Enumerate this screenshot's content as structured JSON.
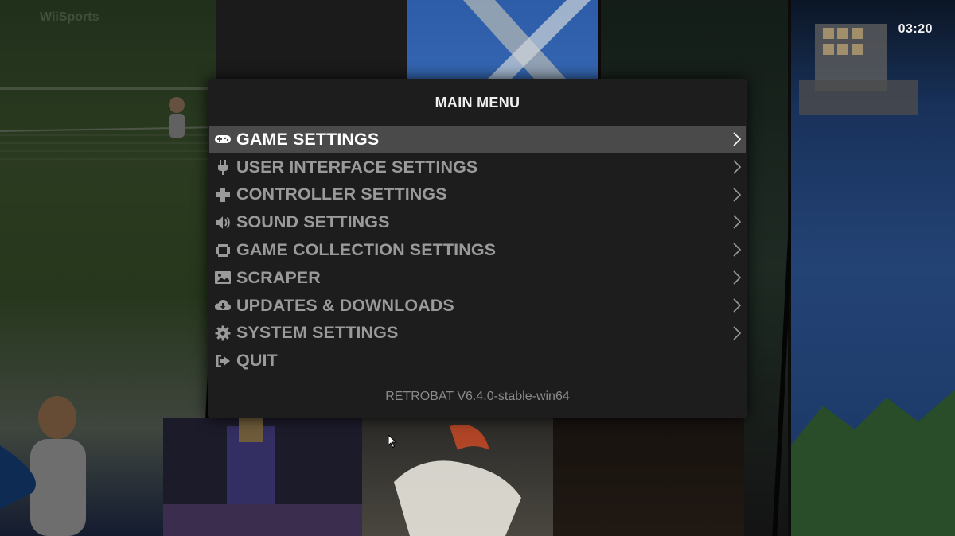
{
  "clock": "03:20",
  "background": {
    "watermark_text": "WiiSports"
  },
  "menu": {
    "title": "MAIN MENU",
    "items": [
      {
        "label": "GAME SETTINGS",
        "icon": "gamepad-icon",
        "selected": true,
        "has_submenu": true
      },
      {
        "label": "USER INTERFACE SETTINGS",
        "icon": "plug-icon",
        "selected": false,
        "has_submenu": true
      },
      {
        "label": "CONTROLLER SETTINGS",
        "icon": "dpad-cross-icon",
        "selected": false,
        "has_submenu": true
      },
      {
        "label": "SOUND SETTINGS",
        "icon": "speaker-icon",
        "selected": false,
        "has_submenu": true
      },
      {
        "label": "GAME COLLECTION SETTINGS",
        "icon": "collection-frame-icon",
        "selected": false,
        "has_submenu": true
      },
      {
        "label": "SCRAPER",
        "icon": "image-icon",
        "selected": false,
        "has_submenu": true
      },
      {
        "label": "UPDATES & DOWNLOADS",
        "icon": "cloud-download-icon",
        "selected": false,
        "has_submenu": true
      },
      {
        "label": "SYSTEM SETTINGS",
        "icon": "gear-icon",
        "selected": false,
        "has_submenu": true
      },
      {
        "label": "QUIT",
        "icon": "exit-icon",
        "selected": false,
        "has_submenu": false
      }
    ],
    "version": "RETROBAT V6.4.0-stable-win64"
  },
  "colors": {
    "menu_bg": "#1d1d1d",
    "selected_bg": "#4a4a4a",
    "text_selected": "#ffffff",
    "text_normal": "#9a9a9a",
    "version_text": "#8a8a8a"
  }
}
